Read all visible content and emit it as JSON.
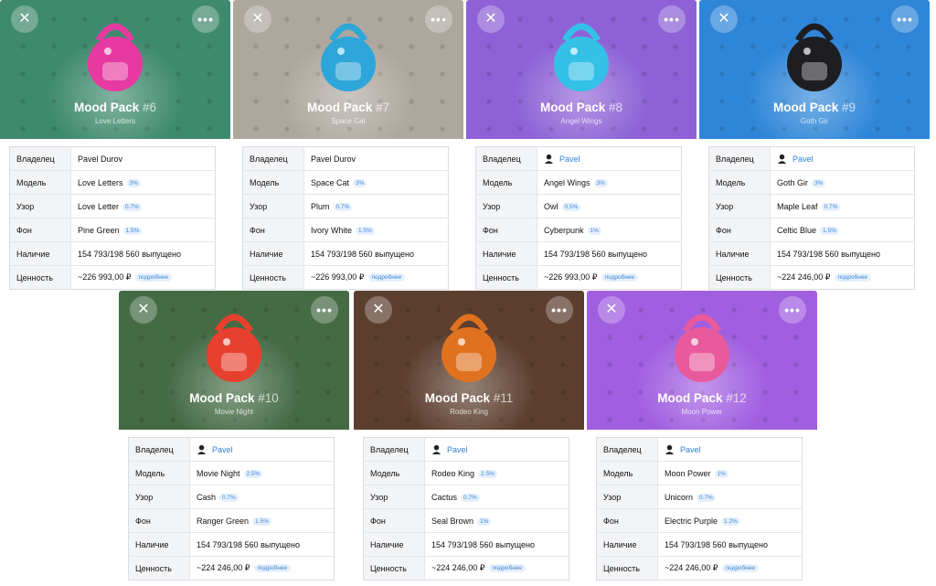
{
  "labels": {
    "owner": "Владелец",
    "model": "Модель",
    "pattern": "Узор",
    "background": "Фон",
    "availability": "Наличие",
    "value": "Ценность",
    "more": "подробнее",
    "close_icon": "✕",
    "more_icon": "•••"
  },
  "cards": [
    {
      "name": "Mood Pack",
      "number": "#6",
      "subtitle": "Love Letters",
      "owner": "Pavel Durov",
      "owner_avatar": false,
      "model": "Love Letters",
      "model_pct": "3%",
      "pattern": "Love Letter",
      "pattern_pct": "0.7%",
      "background": "Pine Green",
      "background_pct": "1.5%",
      "availability": "154 793/198 560 выпущено",
      "value": "~226 993,00 ₽",
      "bg_color": "#3f8a6e",
      "accent": "#e73aa0",
      "icon": "heart-bag-icon"
    },
    {
      "name": "Mood Pack",
      "number": "#7",
      "subtitle": "Space Cat",
      "owner": "Pavel Durov",
      "owner_avatar": false,
      "model": "Space Cat",
      "model_pct": "3%",
      "pattern": "Plum",
      "pattern_pct": "0.7%",
      "background": "Ivory White",
      "background_pct": "1.5%",
      "availability": "154 793/198 560 выпущено",
      "value": "~226 993,00 ₽",
      "bg_color": "#aea79e",
      "accent": "#2ea6d9",
      "icon": "space-cat-backpack-icon"
    },
    {
      "name": "Mood Pack",
      "number": "#8",
      "subtitle": "Angel Wings",
      "owner": "Pavel",
      "owner_avatar": true,
      "model": "Angel Wings",
      "model_pct": "3%",
      "pattern": "Owl",
      "pattern_pct": "0.5%",
      "background": "Cyberpunk",
      "background_pct": "1%",
      "availability": "154 793/198 560 выпущено",
      "value": "~226 993,00 ₽",
      "bg_color": "#8e62d6",
      "accent": "#33c1e8",
      "icon": "angel-wings-backpack-icon"
    },
    {
      "name": "Mood Pack",
      "number": "#9",
      "subtitle": "Goth Gir",
      "owner": "Pavel",
      "owner_avatar": true,
      "model": "Goth Gir",
      "model_pct": "3%",
      "pattern": "Maple Leaf",
      "pattern_pct": "0.7%",
      "background": "Celtic Blue",
      "background_pct": "1.5%",
      "availability": "154 793/198 560 выпущено",
      "value": "~224 246,00 ₽",
      "bg_color": "#2f86d8",
      "accent": "#1e1e22",
      "icon": "goth-backpack-icon"
    },
    {
      "name": "Mood Pack",
      "number": "#10",
      "subtitle": "Movie Night",
      "owner": "Pavel",
      "owner_avatar": true,
      "model": "Movie Night",
      "model_pct": "2.5%",
      "pattern": "Cash",
      "pattern_pct": "0.7%",
      "background": "Ranger Green",
      "background_pct": "1.5%",
      "availability": "154 793/198 560 выпущено",
      "value": "~224 246,00 ₽",
      "bg_color": "#456b45",
      "accent": "#e8402e",
      "icon": "movie-night-backpack-icon"
    },
    {
      "name": "Mood Pack",
      "number": "#11",
      "subtitle": "Rodeo King",
      "owner": "Pavel",
      "owner_avatar": true,
      "model": "Rodeo King",
      "model_pct": "2.5%",
      "pattern": "Cactus",
      "pattern_pct": "0.7%",
      "background": "Seal Brown",
      "background_pct": "1%",
      "availability": "154 793/198 560 выпущено",
      "value": "~224 246,00 ₽",
      "bg_color": "#5c3e2e",
      "accent": "#e0721f",
      "icon": "rodeo-backpack-icon"
    },
    {
      "name": "Mood Pack",
      "number": "#12",
      "subtitle": "Moon Power",
      "owner": "Pavel",
      "owner_avatar": true,
      "model": "Moon Power",
      "model_pct": "1%",
      "pattern": "Unicorn",
      "pattern_pct": "0.7%",
      "background": "Electric Purple",
      "background_pct": "1.2%",
      "availability": "154 793/198 560 выпущено",
      "value": "~224 246,00 ₽",
      "bg_color": "#a05ee0",
      "accent": "#e85a9b",
      "icon": "moon-power-backpack-icon"
    }
  ]
}
